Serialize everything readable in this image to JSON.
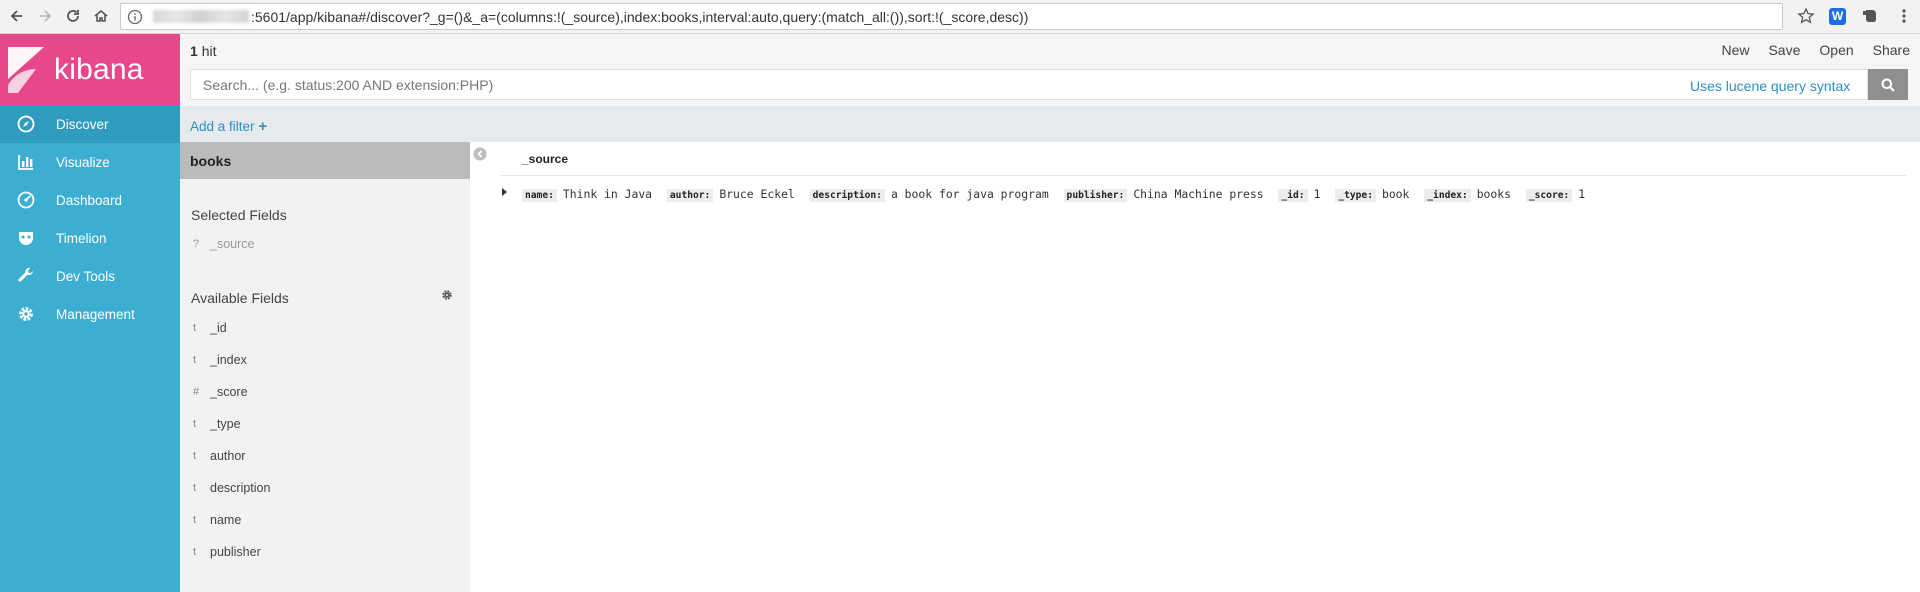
{
  "browser": {
    "url": ":5601/app/kibana#/discover?_g=()&_a=(columns:!(_source),index:books,interval:auto,query:(match_all:()),sort:!(_score,desc))"
  },
  "app": {
    "logo_text": "kibana"
  },
  "colors": {
    "nav_bg": "#3caed2",
    "logo_bg": "#e8478b",
    "link": "#2d8fc5"
  },
  "nav": {
    "items": [
      {
        "label": "Discover",
        "icon": "compass-icon"
      },
      {
        "label": "Visualize",
        "icon": "bar-chart-icon"
      },
      {
        "label": "Dashboard",
        "icon": "dashboard-gauge-icon"
      },
      {
        "label": "Timelion",
        "icon": "timelion-mask-icon"
      },
      {
        "label": "Dev Tools",
        "icon": "wrench-icon"
      },
      {
        "label": "Management",
        "icon": "gear-icon"
      }
    ]
  },
  "header": {
    "hits_count": "1",
    "hits_label": "hit",
    "menu": [
      "New",
      "Save",
      "Open",
      "Share"
    ]
  },
  "search": {
    "placeholder": "Search... (e.g. status:200 AND extension:PHP)",
    "lucene_link": "Uses lucene query syntax"
  },
  "filter": {
    "add_label": "Add a filter",
    "plus": "+"
  },
  "sidebar": {
    "index_name": "books",
    "selected_title": "Selected Fields",
    "selected_fields": [
      {
        "type": "?",
        "name": "_source"
      }
    ],
    "available_title": "Available Fields",
    "available_fields": [
      {
        "type": "t",
        "name": "_id"
      },
      {
        "type": "t",
        "name": "_index"
      },
      {
        "type": "#",
        "name": "_score"
      },
      {
        "type": "t",
        "name": "_type"
      },
      {
        "type": "t",
        "name": "author"
      },
      {
        "type": "t",
        "name": "description"
      },
      {
        "type": "t",
        "name": "name"
      },
      {
        "type": "t",
        "name": "publisher"
      }
    ]
  },
  "table": {
    "column_header": "_source",
    "row": [
      {
        "key": "name:",
        "value": "Think in Java"
      },
      {
        "key": "author:",
        "value": "Bruce Eckel"
      },
      {
        "key": "description:",
        "value": "a book for java program"
      },
      {
        "key": "publisher:",
        "value": "China Machine press"
      },
      {
        "key": "_id:",
        "value": "1"
      },
      {
        "key": "_type:",
        "value": "book"
      },
      {
        "key": "_index:",
        "value": "books"
      },
      {
        "key": "_score:",
        "value": "1"
      }
    ]
  }
}
